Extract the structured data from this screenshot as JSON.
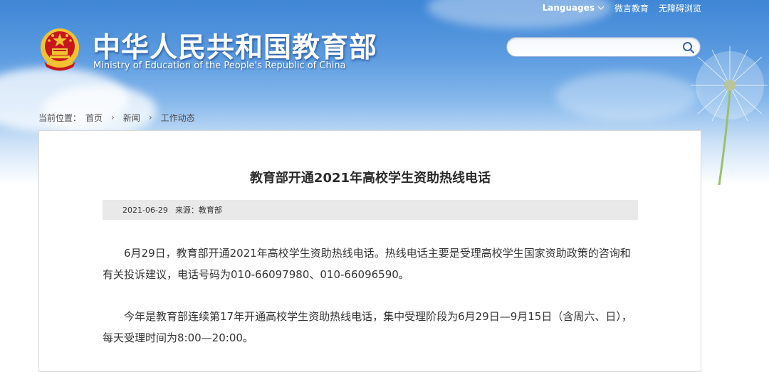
{
  "header": {
    "languages_label": "Languages",
    "links": [
      "微言教育",
      "无障碍浏览"
    ],
    "title_cn": "中华人民共和国教育部",
    "title_en": "Ministry of Education of the People's Republic of China",
    "search_placeholder": ""
  },
  "breadcrumb": {
    "prefix": "当前位置：",
    "items": [
      "首页",
      "新闻",
      "工作动态"
    ]
  },
  "article": {
    "title": "教育部开通2021年高校学生资助热线电话",
    "date": "2021-06-29",
    "source": "来源：教育部",
    "paragraphs": [
      "6月29日，教育部开通2021年高校学生资助热线电话。热线电话主要是受理高校学生国家资助政策的咨询和有关投诉建议，电话号码为010-66097980、010-66096590。",
      "今年是教育部连续第17年开通高校学生资助热线电话，集中受理阶段为6月29日—9月15日（含周六、日），每天受理时间为8:00—20:00。"
    ]
  },
  "colors": {
    "sky_top": "#3f86d6",
    "emblem_red": "#c8161d",
    "emblem_gold": "#f2c230"
  }
}
